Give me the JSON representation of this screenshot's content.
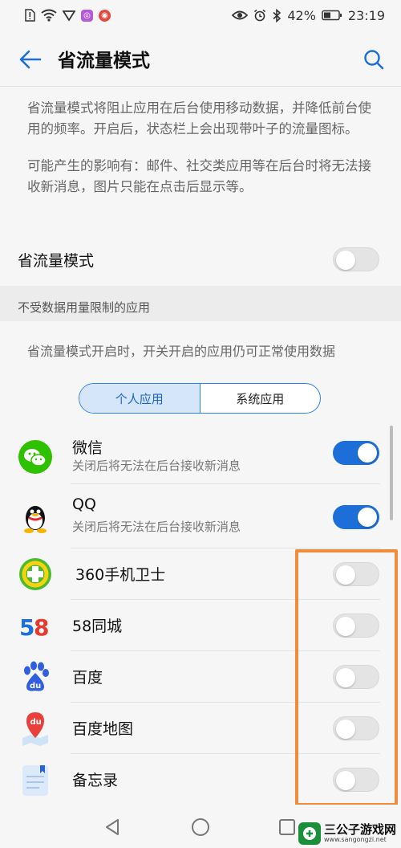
{
  "status_bar": {
    "battery": "42%",
    "time": "23:19"
  },
  "header": {
    "title": "省流量模式"
  },
  "description": {
    "p1": "省流量模式将阻止应用在后台使用移动数据，并降低前台使用的频率。开启后，状态栏上会出现带叶子的流量图标。",
    "p2": "可能产生的影响有：邮件、社交类应用等在后台时将无法接收新消息，图片只能在点击后显示等。"
  },
  "main_toggle": {
    "label": "省流量模式",
    "on": false
  },
  "section": {
    "title": "不受数据用量限制的应用",
    "note": "省流量模式开启时，开关开启的应用仍可正常使用数据"
  },
  "tabs": {
    "personal": "个人应用",
    "system": "系统应用",
    "selected": "个人应用"
  },
  "apps": [
    {
      "name": "微信",
      "subtitle": "关闭后将无法在后台接收新消息",
      "icon": "wechat-icon",
      "on": true
    },
    {
      "name": "QQ",
      "subtitle": "关闭后将无法在后台接收新消息",
      "icon": "qq-icon",
      "on": true
    },
    {
      "name": "360手机卫士",
      "subtitle": "",
      "icon": "360-security-icon",
      "on": false
    },
    {
      "name": "58同城",
      "subtitle": "",
      "icon": "58-tongcheng-icon",
      "on": false
    },
    {
      "name": "百度",
      "subtitle": "",
      "icon": "baidu-icon",
      "on": false
    },
    {
      "name": "百度地图",
      "subtitle": "",
      "icon": "baidu-map-icon",
      "on": false
    },
    {
      "name": "备忘录",
      "subtitle": "",
      "icon": "memo-icon",
      "on": false
    }
  ],
  "watermark": {
    "text": "三公子游戏网",
    "url": "www.sangongzi.net"
  },
  "colors": {
    "accent": "#1c6fd8",
    "highlight": "#f08c3a",
    "toggle_off": "#e4e4e4"
  }
}
